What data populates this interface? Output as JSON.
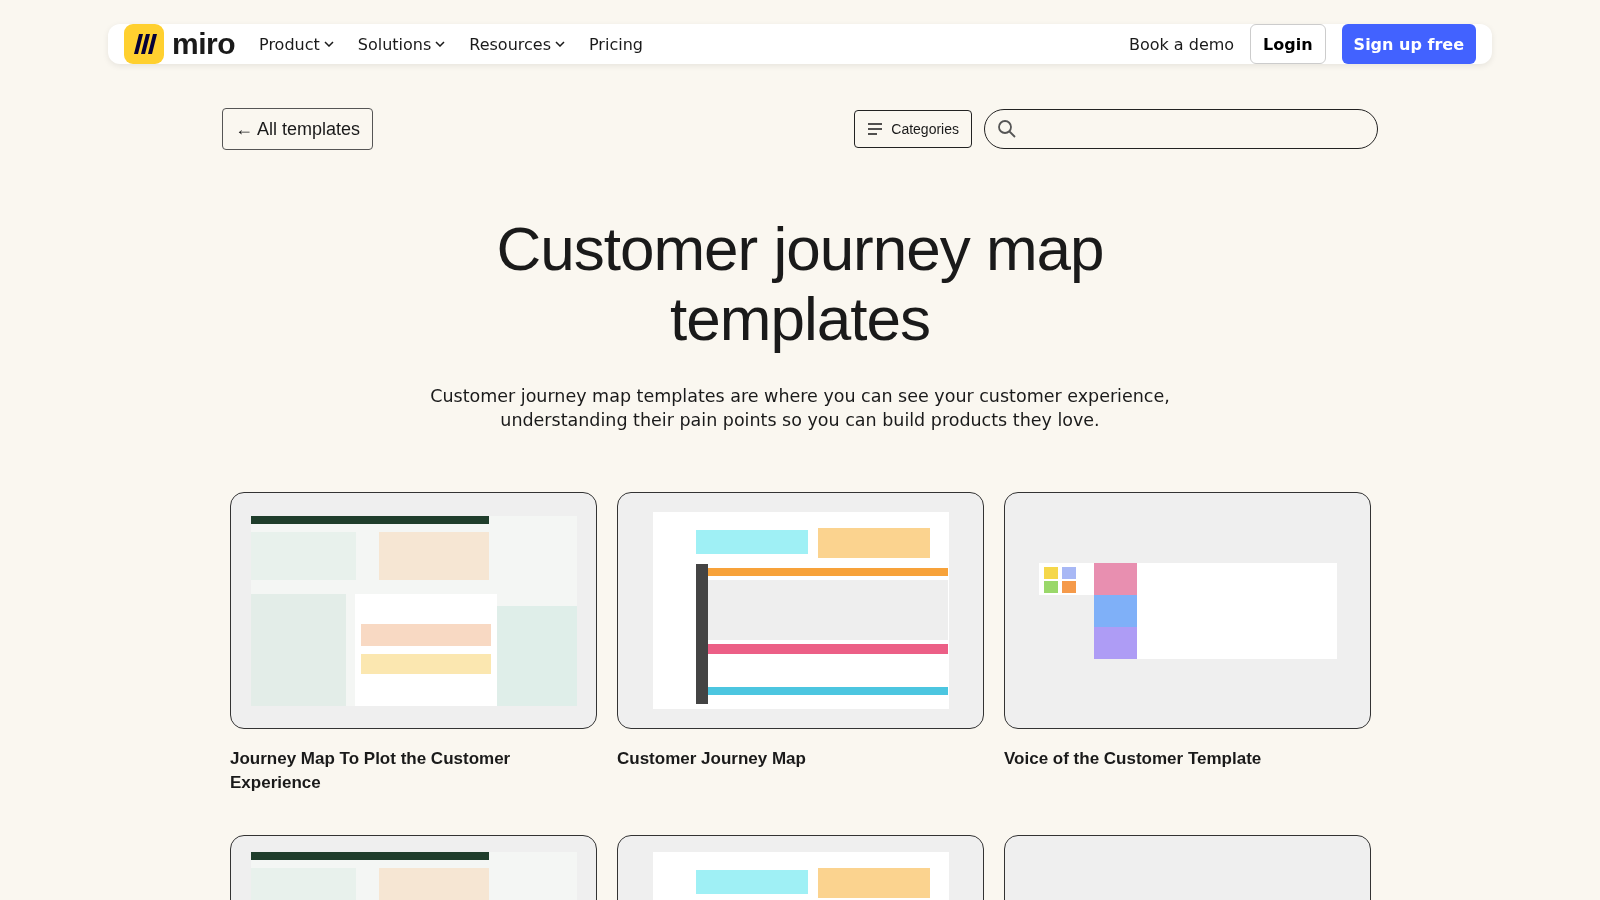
{
  "header": {
    "logo_text": "miro",
    "nav": [
      {
        "label": "Product",
        "dropdown": true
      },
      {
        "label": "Solutions",
        "dropdown": true
      },
      {
        "label": "Resources",
        "dropdown": true
      },
      {
        "label": "Pricing",
        "dropdown": false
      }
    ],
    "book_demo": "Book a demo",
    "login": "Login",
    "signup": "Sign up free"
  },
  "toolbar": {
    "back": "All templates",
    "back_arrow": "←",
    "categories": "Categories"
  },
  "hero": {
    "title": "Customer journey map templates",
    "description": "Customer journey map templates are where you can see your customer experience, understanding their pain points so you can build products they love."
  },
  "templates": [
    {
      "kind": "picture",
      "title": "Journey Map To Plot the Customer Experience"
    },
    {
      "kind": "picture",
      "title": "Customer Journey Map"
    },
    {
      "kind": "picture",
      "title": "Voice of the Customer Template"
    },
    {
      "kind": "picture"
    },
    {
      "kind": "picture"
    },
    {
      "kind": "empty"
    }
  ]
}
